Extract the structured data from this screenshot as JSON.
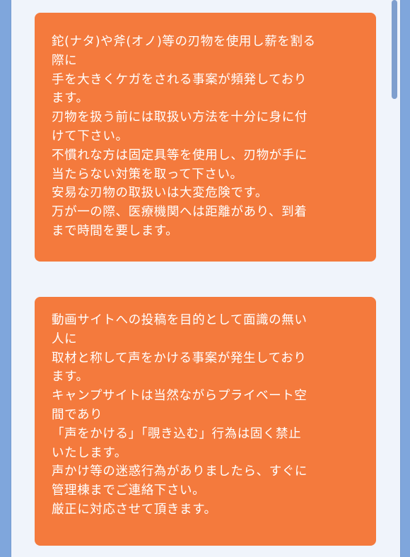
{
  "notices": [
    {
      "lines": [
        "鉈(ナタ)や斧(オノ)等の刃物を使用し薪を割る",
        "際に",
        "手を大きくケガをされる事案が頻発しており",
        "ます。",
        "刃物を扱う前には取扱い方法を十分に身に付",
        "けて下さい。",
        "不慣れな方は固定具等を使用し、刃物が手に",
        "当たらない対策を取って下さい。",
        "安易な刃物の取扱いは大変危険です。",
        "万が一の際、医療機関へは距離があり、到着",
        "まで時間を要します。"
      ]
    },
    {
      "lines": [
        "動画サイトへの投稿を目的として面識の無い",
        "人に",
        "取材と称して声をかける事案が発生しており",
        "ます。",
        "キャンプサイトは当然ながらプライベート空",
        "間であり",
        "「声をかける」「覗き込む」行為は固く禁止",
        "いたします。",
        "声かけ等の迷惑行為がありましたら、すぐに",
        "管理棟までご連絡下さい。",
        "厳正に対応させて頂きます。"
      ]
    }
  ],
  "colors": {
    "background": "#7fa6dc",
    "page": "#f0f4fb",
    "notice": "#f47a3d",
    "text": "#ffffff"
  }
}
